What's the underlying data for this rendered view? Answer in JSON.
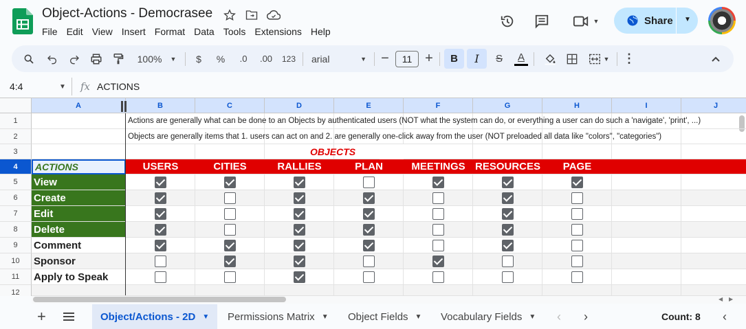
{
  "app": {
    "title": "Object-Actions - Democrasee",
    "menu": [
      "File",
      "Edit",
      "View",
      "Insert",
      "Format",
      "Data",
      "Tools",
      "Extensions",
      "Help"
    ],
    "share_label": "Share"
  },
  "toolbar": {
    "zoom": "100%",
    "currency": "$",
    "percent": "%",
    "dec_decrease": ".0",
    "dec_increase": ".00",
    "number_format": "123",
    "font": "arial",
    "font_size": "11",
    "bold": "B",
    "italic": "I",
    "text_color_letter": "A"
  },
  "formula_bar": {
    "name_box": "4:4",
    "fx": "fx",
    "value": "ACTIONS"
  },
  "columns": [
    "A",
    "B",
    "C",
    "D",
    "E",
    "F",
    "G",
    "H",
    "I",
    "J"
  ],
  "selected_row": "4",
  "rows": {
    "r1": "Actions are generally what can be done to an Objects by authenticated users (NOT what the system can do, or everything a user can do such a 'navigate', 'print', ...)",
    "r2": "Objects are generally items that 1. users can act on and 2. are generally one-click away from the user (NOT preloaded all data like \"colors\", \"categories\")",
    "r3": "OBJECTS",
    "headers": [
      "ACTIONS",
      "USERS",
      "CITIES",
      "RALLIES",
      "PLAN",
      "MEETINGS",
      "RESOURCES",
      "PAGE"
    ],
    "actions": [
      "View",
      "Create",
      "Edit",
      "Delete",
      "Comment",
      "Sponsor",
      "Apply to Speak"
    ],
    "checks": [
      [
        true,
        true,
        true,
        false,
        true,
        true,
        true
      ],
      [
        true,
        false,
        true,
        true,
        false,
        true,
        false
      ],
      [
        true,
        false,
        true,
        true,
        false,
        true,
        false
      ],
      [
        true,
        false,
        true,
        true,
        false,
        true,
        false
      ],
      [
        true,
        true,
        true,
        true,
        false,
        true,
        false
      ],
      [
        false,
        true,
        true,
        false,
        true,
        false,
        false
      ],
      [
        false,
        false,
        true,
        false,
        false,
        false,
        false
      ]
    ]
  },
  "tabs": {
    "items": [
      "Object/Actions - 2D",
      "Permissions Matrix",
      "Object Fields",
      "Vocabulary Fields"
    ],
    "active": 0,
    "count": "Count: 8"
  },
  "colors": {
    "green": "#38761d",
    "red": "#e00000",
    "accent": "#0b57d0"
  }
}
